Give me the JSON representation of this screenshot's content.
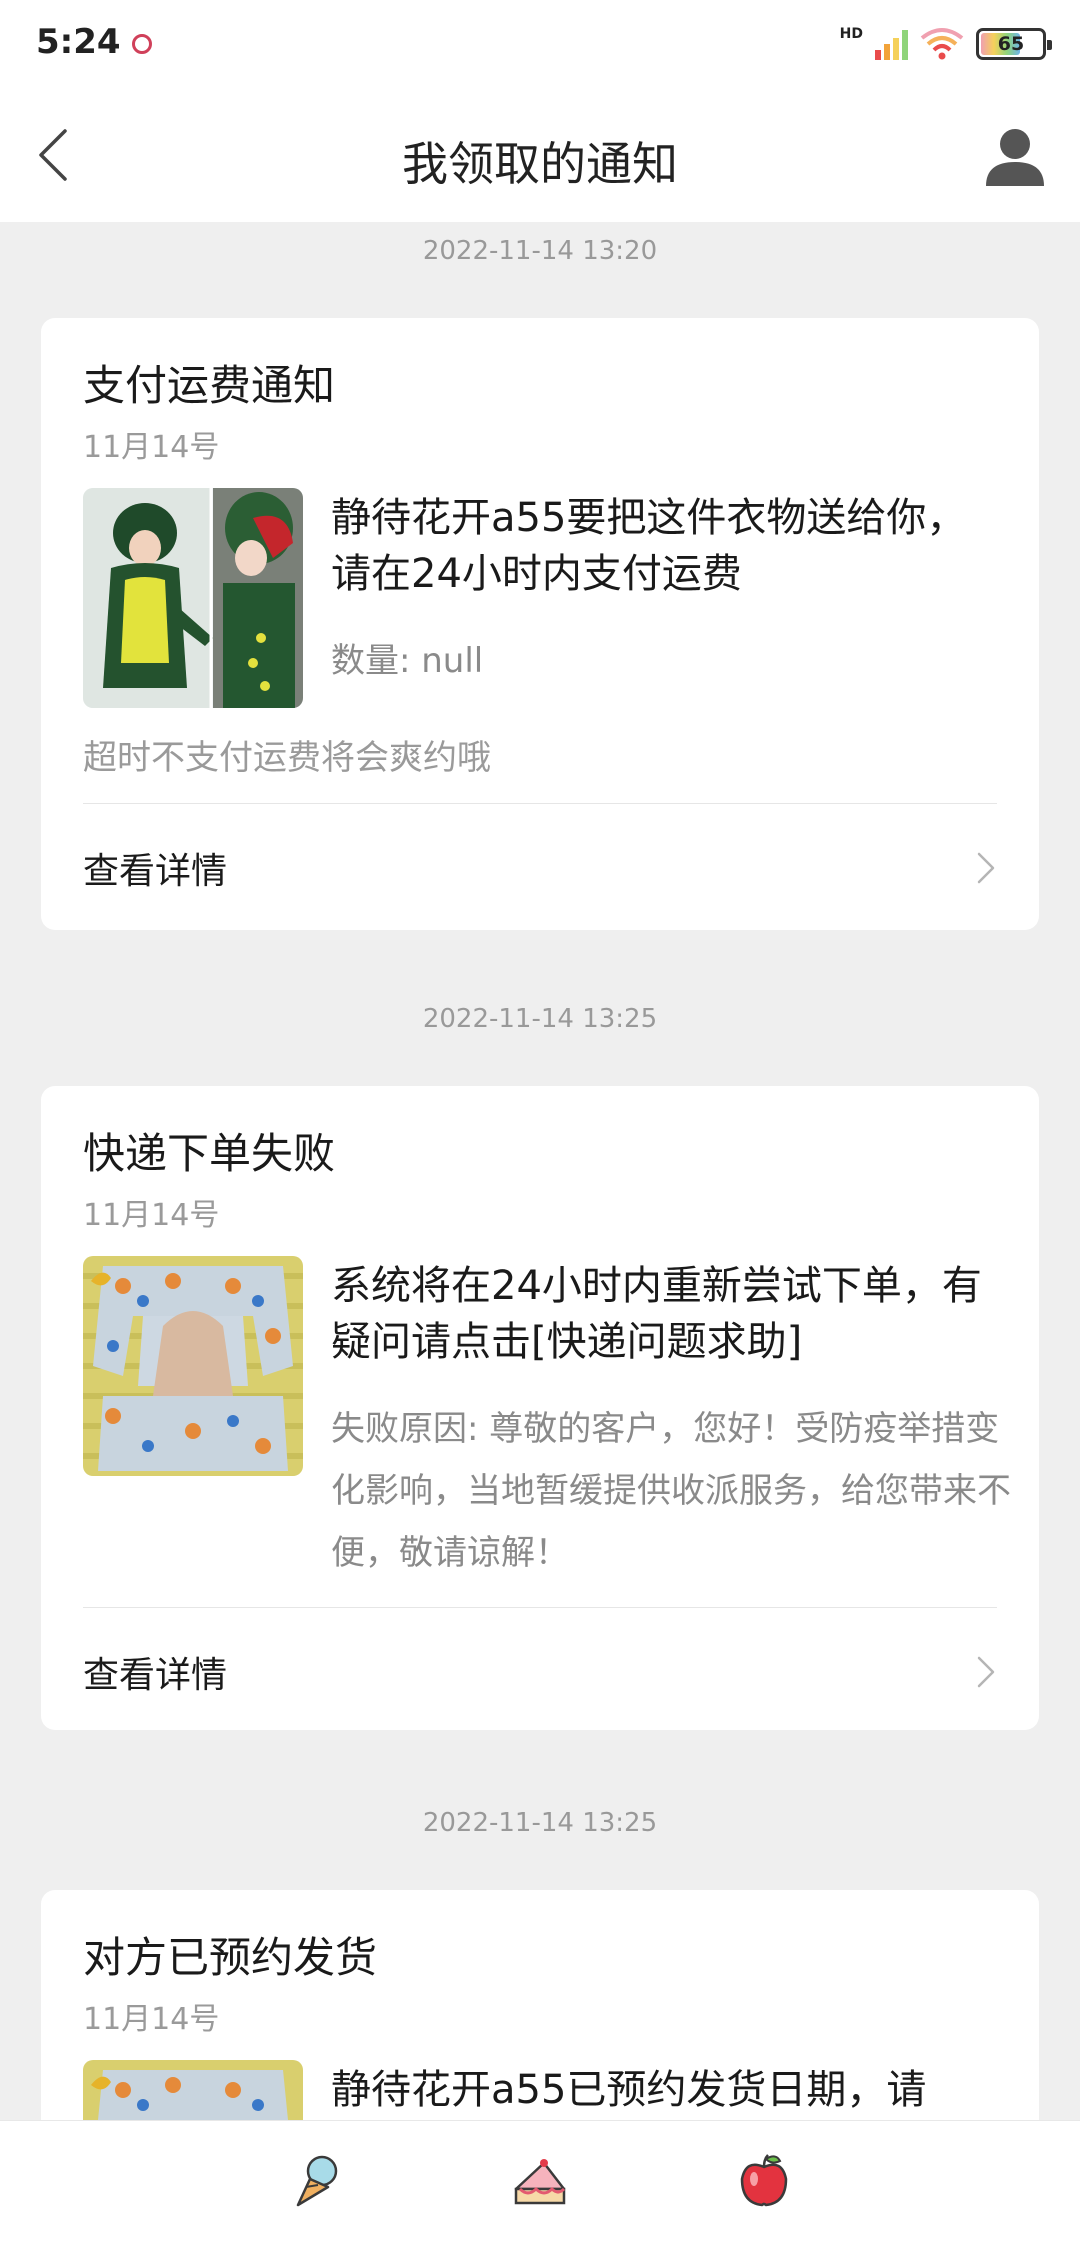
{
  "status_bar": {
    "time": "5:24",
    "network_label": "HD",
    "battery_level": "65"
  },
  "header": {
    "title": "我领取的通知",
    "back_icon": "chevron-left-icon",
    "profile_icon": "user-icon"
  },
  "notifications": [
    {
      "timestamp": "2022-11-14 13:20",
      "title": "支付运费通知",
      "date": "11月14号",
      "message": "静待花开a55要把这件衣物送给你，请在24小时内支付运费",
      "detail": "数量: null",
      "note": "超时不支付运费将会爽约哦",
      "action_label": "查看详情",
      "thumbnail": "dinosaur-costume"
    },
    {
      "timestamp": "2022-11-14 13:25",
      "title": "快递下单失败",
      "date": "11月14号",
      "message": "系统将在24小时内重新尝试下单，有疑问请点击[快递问题求助]",
      "detail": "失败原因: 尊敬的客户，您好！受防疫举措变化影响，当地暂缓提供收派服务，给您带来不便，敬请谅解！",
      "action_label": "查看详情",
      "thumbnail": "pajamas"
    },
    {
      "timestamp": "2022-11-14 13:25",
      "title": "对方已预约发货",
      "date": "11月14号",
      "message": "静待花开a55已预约发货日期，请",
      "thumbnail": "pajamas"
    }
  ],
  "bottom_nav": [
    {
      "icon": "ice-cream-icon"
    },
    {
      "icon": "cake-icon"
    },
    {
      "icon": "apple-icon"
    }
  ],
  "colors": {
    "background": "#efefef",
    "card": "#ffffff",
    "secondary_text": "#9a9a9a",
    "battery_accent": "#f5d15a"
  }
}
